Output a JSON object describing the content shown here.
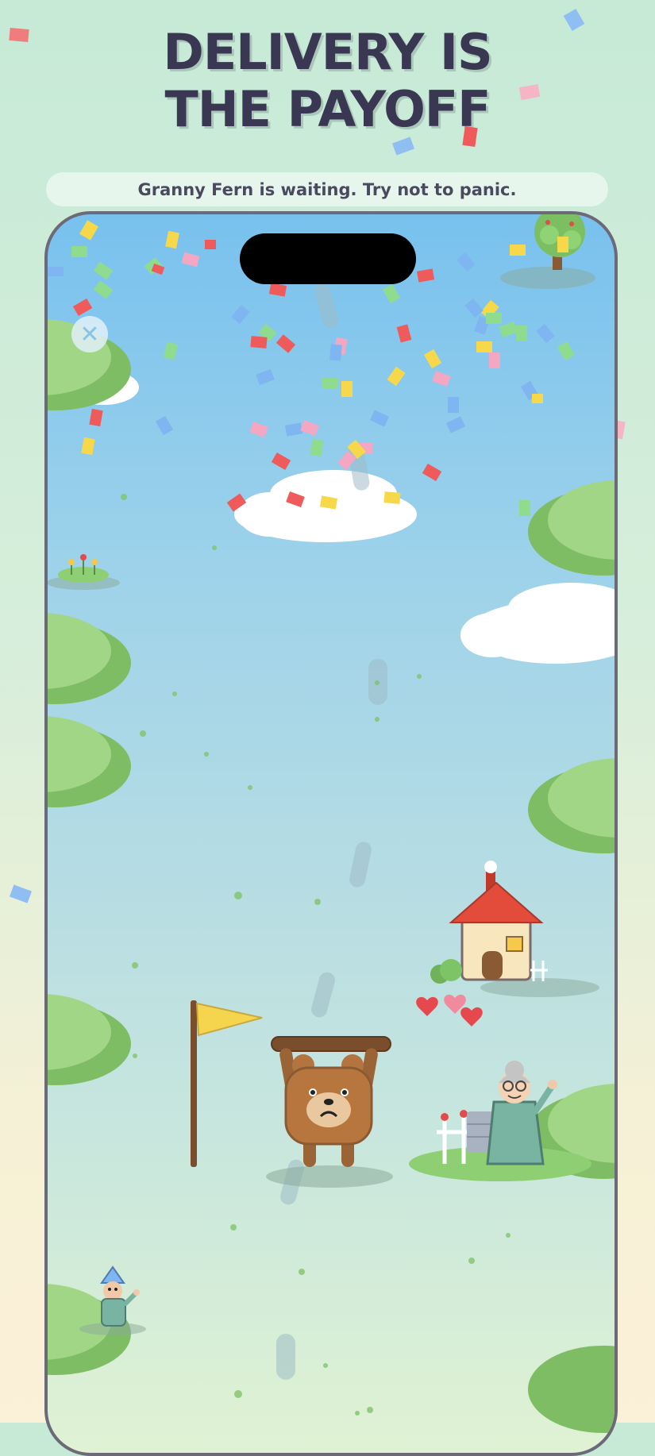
{
  "header": {
    "title_line1": "DELIVERY IS",
    "title_line2": "THE PAYOFF"
  },
  "subtitle": "Granny Fern is waiting. Try not to panic.",
  "game": {
    "close_button_glyph": "✕",
    "icons": {
      "close": "close-icon",
      "flag": "flag-icon",
      "player": "bear-carrying-plank",
      "house": "house-icon",
      "granny": "granny-character",
      "gnome": "gnome-character",
      "hearts": "heart-icon",
      "tree": "apple-tree-icon"
    },
    "colors": {
      "sky_top": "#78c1ee",
      "grass": "#8fcf74",
      "title": "#3a3752",
      "confetti_red": "#ef5a5a",
      "confetti_yellow": "#f7d84a",
      "confetti_pink": "#f3a7c2",
      "confetti_green": "#8fdc8f",
      "confetti_blue": "#7fb5f0"
    }
  }
}
